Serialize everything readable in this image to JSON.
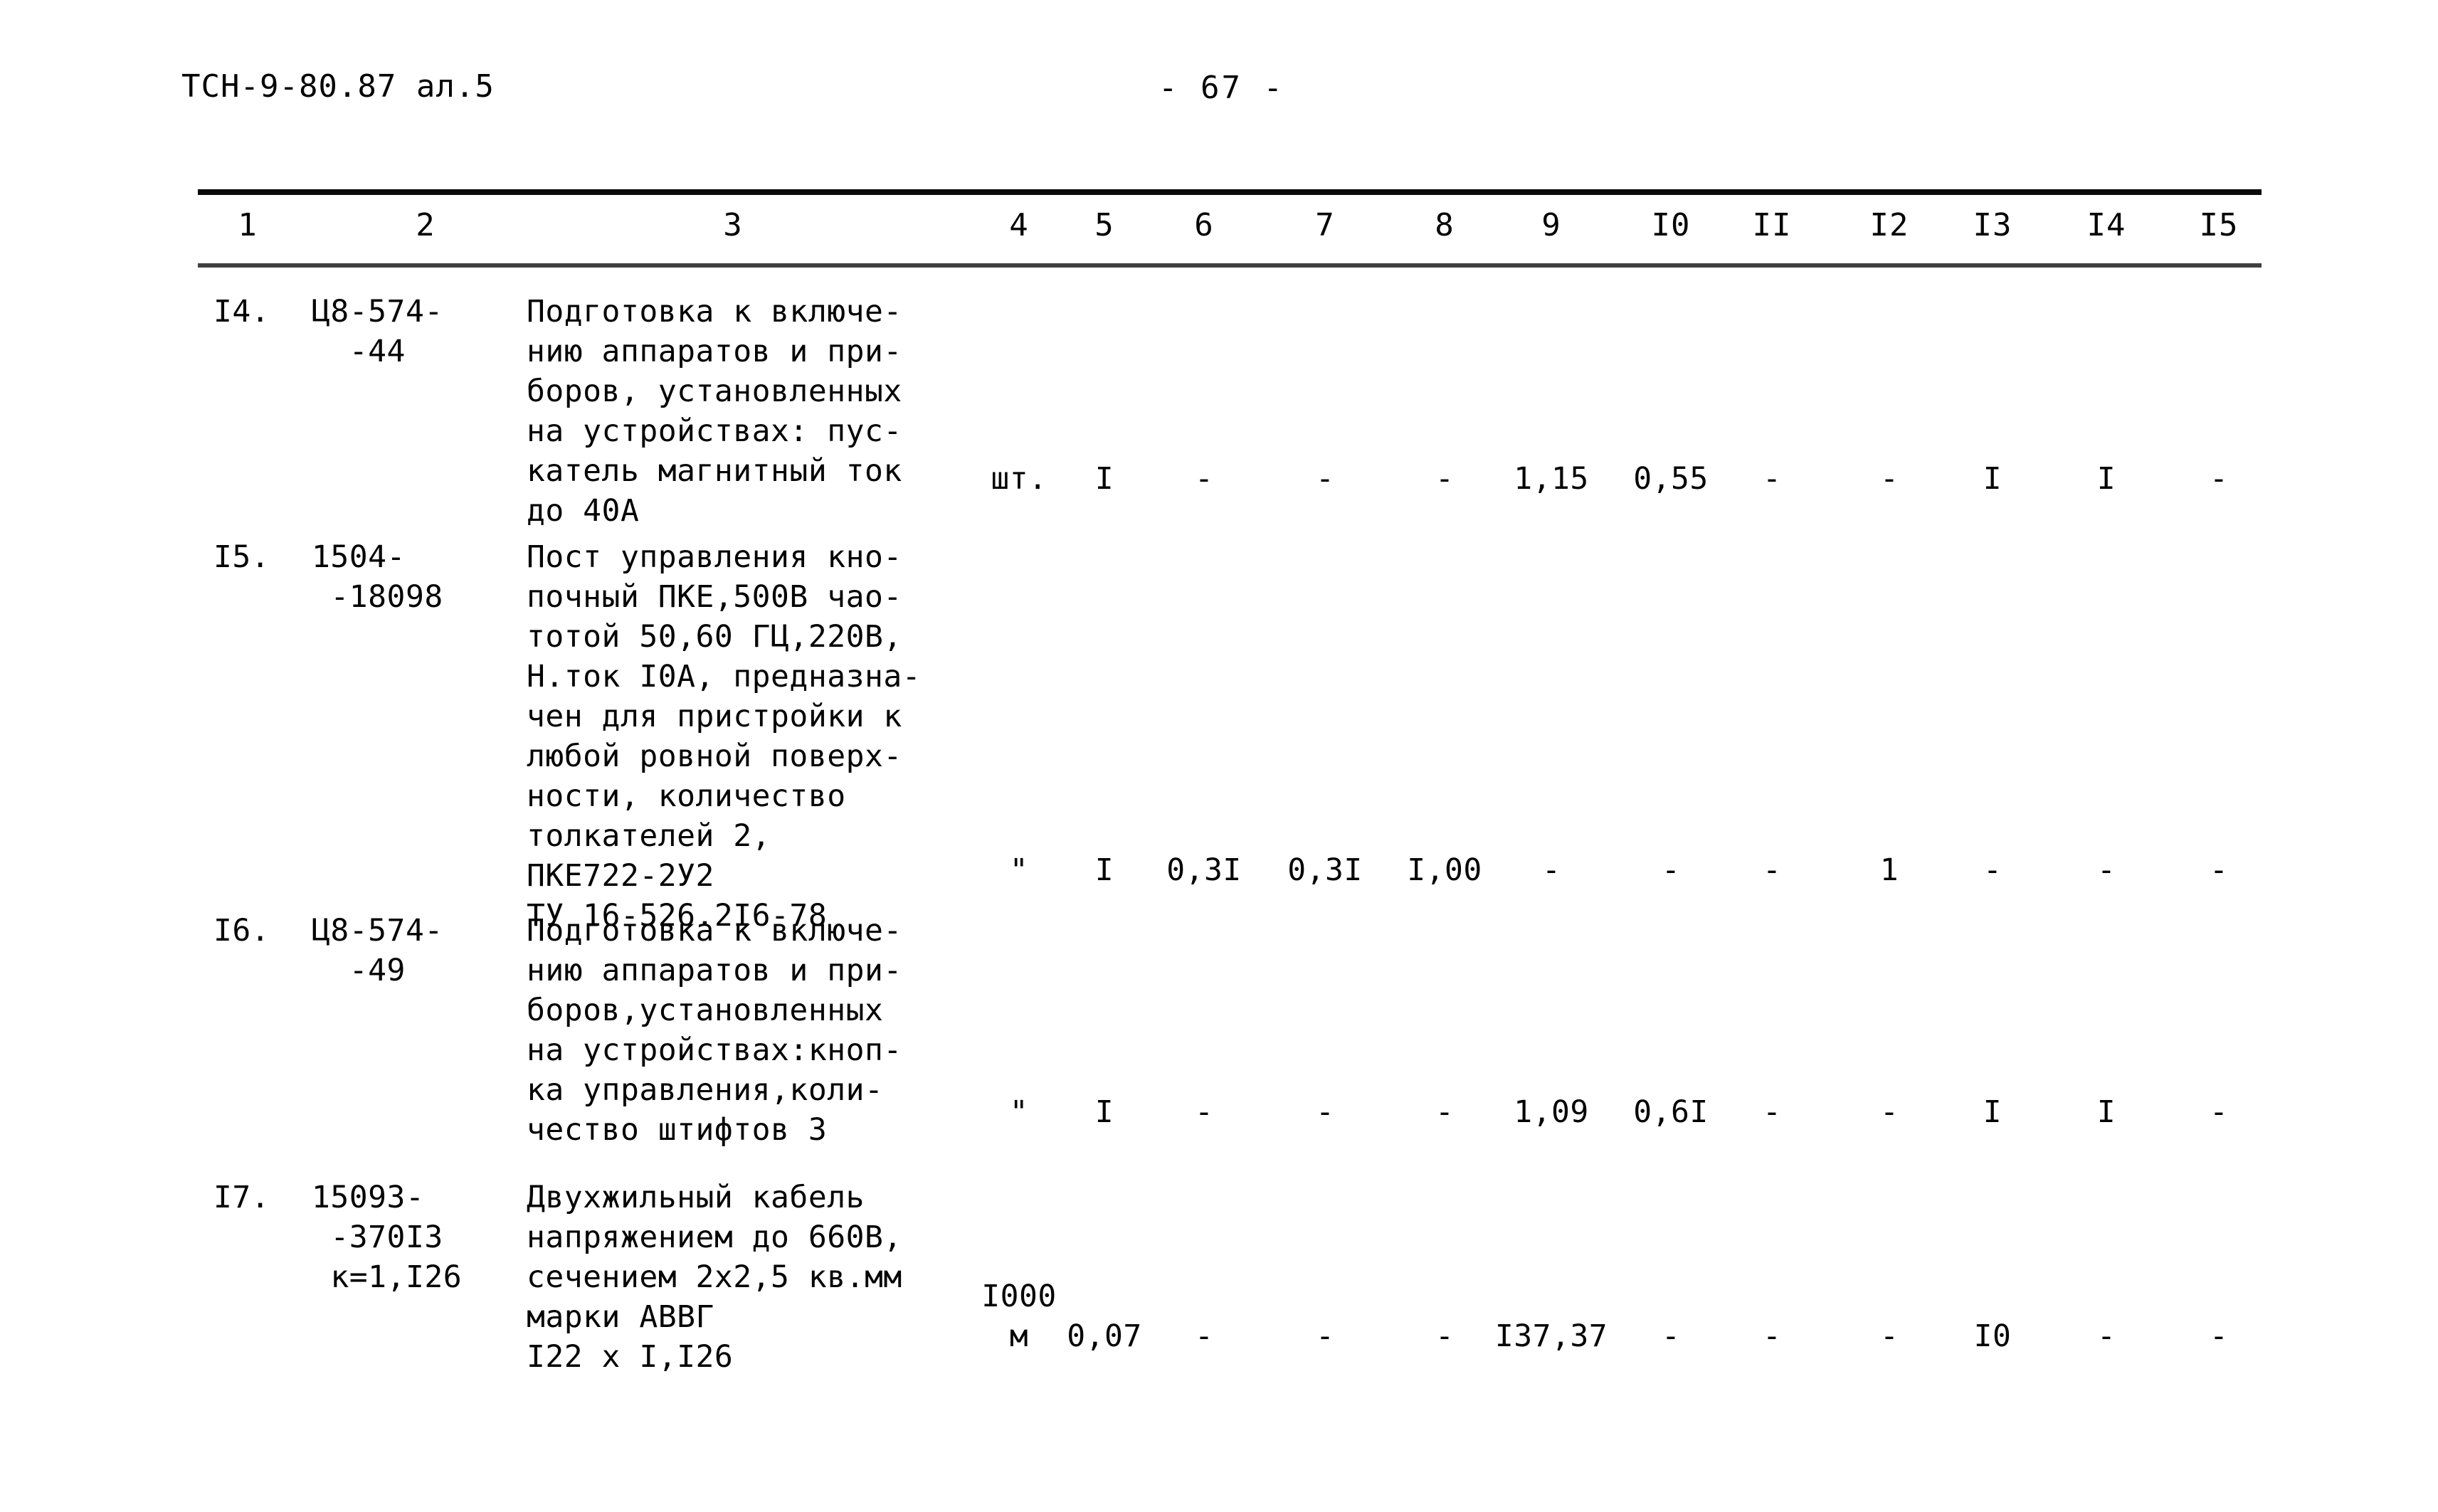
{
  "header": {
    "doc_code": "ТСН-9-80.87 ал.5",
    "page_number": "- 67 -"
  },
  "table": {
    "column_headers": [
      "1",
      "2",
      "3",
      "4",
      "5",
      "6",
      "7",
      "8",
      "9",
      "I0",
      "II",
      "I2",
      "I3",
      "I4",
      "I5"
    ],
    "rows": [
      {
        "num": "I4.",
        "code": "Ц8-574-\n  -44",
        "description": "Подготовка к включе-\nнию аппаратов и при-\nборов, установленных\nна устройствах: пус-\nкатель магнитный ток\nдо 40А",
        "unit": "шт.",
        "values": [
          "I",
          "-",
          "-",
          "-",
          "1,15",
          "0,55",
          "-",
          "-",
          "I",
          "I",
          "-"
        ]
      },
      {
        "num": "I5.",
        "code": "1504-\n -18098",
        "description": "Пост управления кно-\nпочный ПКЕ,500В чао-\nтотой 50,60 ГЦ,220В,\nН.ток I0А, предназна-\nчен для пристройки к\nлюбой ровной поверх-\nности, количество\nтолкателей 2,\nПКЕ722-2У2\nТУ 16-526.2I6-78",
        "unit": "\"",
        "values": [
          "I",
          "0,3I",
          "0,3I",
          "I,00",
          "-",
          "-",
          "-",
          "1",
          "-",
          "-",
          "-"
        ]
      },
      {
        "num": "I6.",
        "code": "Ц8-574-\n  -49",
        "description": "Подготовка к включе-\nнию аппаратов и при-\nборов,установленных\nна устройствах:кноп-\nка управления,коли-\nчество штифтов 3",
        "unit": "\"",
        "values": [
          "I",
          "-",
          "-",
          "-",
          "1,09",
          "0,6I",
          "-",
          "-",
          "I",
          "I",
          "-"
        ]
      },
      {
        "num": "I7.",
        "code": "15093-\n -370I3\n к=1,I26",
        "description": "Двухжильный кабель\nнапряжением до 660В,\nсечением 2х2,5 кв.мм\nмарки АВВГ\nI22 х I,I26",
        "unit": "I000\nм",
        "values": [
          "0,07",
          "-",
          "-",
          "-",
          "I37,37",
          "-",
          "-",
          "-",
          "I0",
          "-",
          "-"
        ]
      }
    ]
  }
}
